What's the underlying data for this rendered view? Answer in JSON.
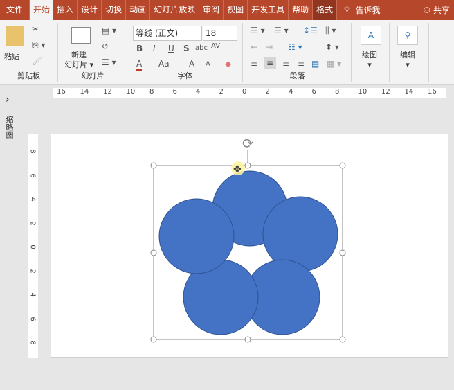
{
  "tabs": [
    "文件",
    "开始",
    "插入",
    "设计",
    "切换",
    "动画",
    "幻灯片放映",
    "审阅",
    "视图",
    "开发工具",
    "帮助",
    "格式"
  ],
  "tell_me": "告诉我",
  "share": "共享",
  "ribbon": {
    "clipboard": {
      "label": "剪贴板",
      "paste": "粘贴"
    },
    "slides": {
      "label": "幻灯片",
      "new_slide_1": "新建",
      "new_slide_2": "幻灯片"
    },
    "font": {
      "label": "字体",
      "font_name": "等线 (正文)",
      "font_size": "18",
      "bold": "B",
      "italic": "I",
      "underline": "U",
      "shadow": "S",
      "strike": "abc",
      "spacing": "AV",
      "color": "A",
      "case": "Aa",
      "grow": "A",
      "shrink": "A"
    },
    "paragraph": {
      "label": "段落"
    },
    "drawing": {
      "label": "绘图"
    },
    "editing": {
      "label": "编辑"
    }
  },
  "sidebar": {
    "label": "缩略图",
    "expand": "›"
  },
  "ruler_h": [
    "16",
    "14",
    "12",
    "10",
    "8",
    "6",
    "4",
    "2",
    "0",
    "2",
    "4",
    "6",
    "8",
    "10",
    "12",
    "14",
    "16"
  ],
  "ruler_v": [
    "8",
    "6",
    "4",
    "2",
    "0",
    "2",
    "4",
    "6",
    "8"
  ],
  "colors": {
    "accent": "#b7472a",
    "shape": "#4472c4",
    "shape_border": "#2f528f"
  }
}
